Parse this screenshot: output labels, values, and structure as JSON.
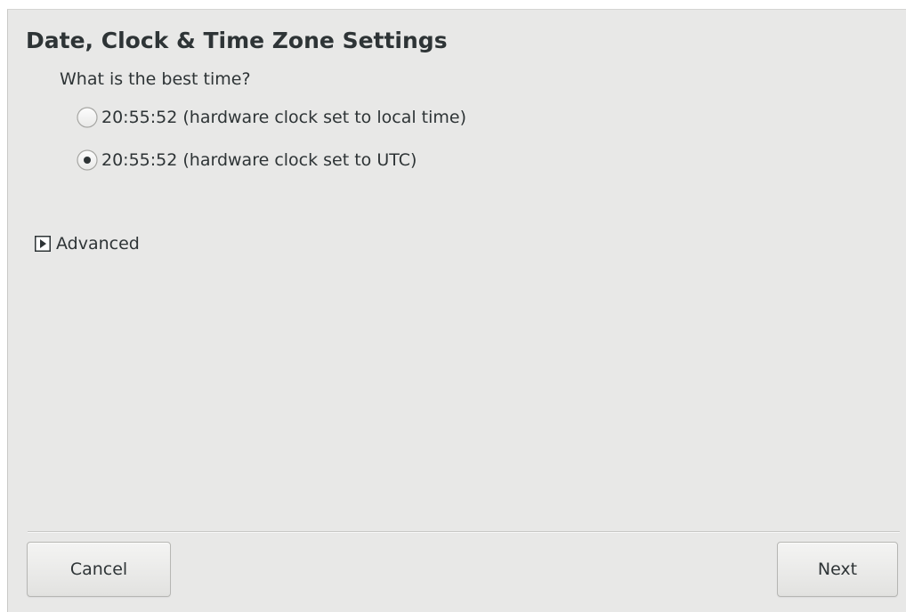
{
  "page": {
    "title": "Date, Clock & Time Zone Settings",
    "question": "What is the best time?"
  },
  "options": [
    {
      "label": "20:55:52 (hardware clock set to local time)",
      "selected": false
    },
    {
      "label": "20:55:52 (hardware clock set to UTC)",
      "selected": true
    }
  ],
  "advanced": {
    "label": "Advanced",
    "expanded": false,
    "icon": "triangle-right-icon"
  },
  "buttons": {
    "cancel_label": "Cancel",
    "next_label": "Next"
  },
  "colors": {
    "background": "#e8e8e7",
    "text": "#2e3436"
  }
}
